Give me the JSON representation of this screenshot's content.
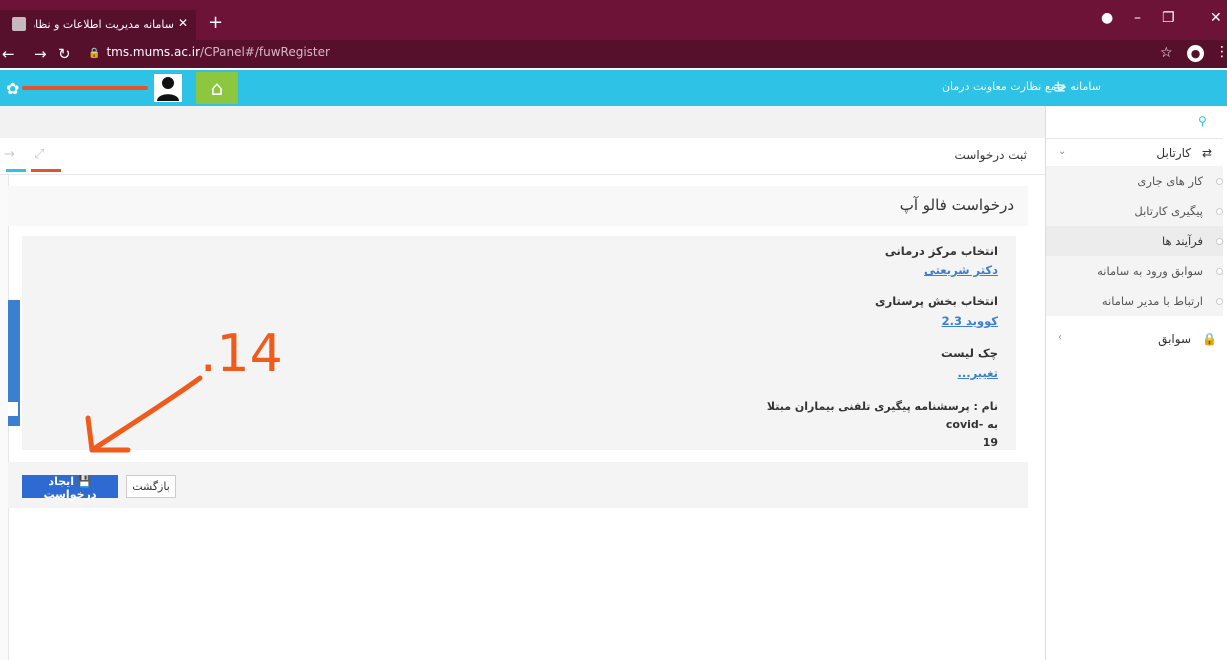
{
  "browser": {
    "tab_title": "سامانه مدیریت اطلاعات و نظارت ...",
    "url_host": "tms.mums.ac.ir",
    "url_path": "/CPanel#/fuwRegister"
  },
  "header": {
    "app_name": "سامانه جامع نظارت معاونت درمان"
  },
  "sidebar": {
    "groups": [
      {
        "label": "کارتابل"
      },
      {
        "label": "سوابق"
      }
    ],
    "items": [
      {
        "label": "کار های جاری"
      },
      {
        "label": "پیگیری کارتابل"
      },
      {
        "label": "فرآیند ها"
      },
      {
        "label": "سوابق ورود به سامانه"
      },
      {
        "label": "ارتباط با مدیر سامانه"
      }
    ]
  },
  "page": {
    "title": "ثبت درخواست",
    "heading": "درخواست فالو آپ",
    "fields": [
      {
        "label": "انتخاب مرکز درمانی",
        "value": "دکتر شریعتی"
      },
      {
        "label": "انتخاب بخش پرستاری",
        "value": "کووید 2.3"
      },
      {
        "label": "چک لیست",
        "value": "تغییر..."
      }
    ],
    "name_line1": "نام : پرسشنامه پیگیری تلفنی بیماران مبتلا به -covid",
    "name_line2": "19"
  },
  "buttons": {
    "create": "ایجاد درخواست",
    "back": "بازگشت"
  },
  "annotation": {
    "label": ".14",
    "color": "#f05a1a"
  },
  "colors": {
    "tabstrip": "#6e1338",
    "header": "#2ec2e6",
    "home": "#8dc63f",
    "primary_button": "#2d6bd3"
  }
}
